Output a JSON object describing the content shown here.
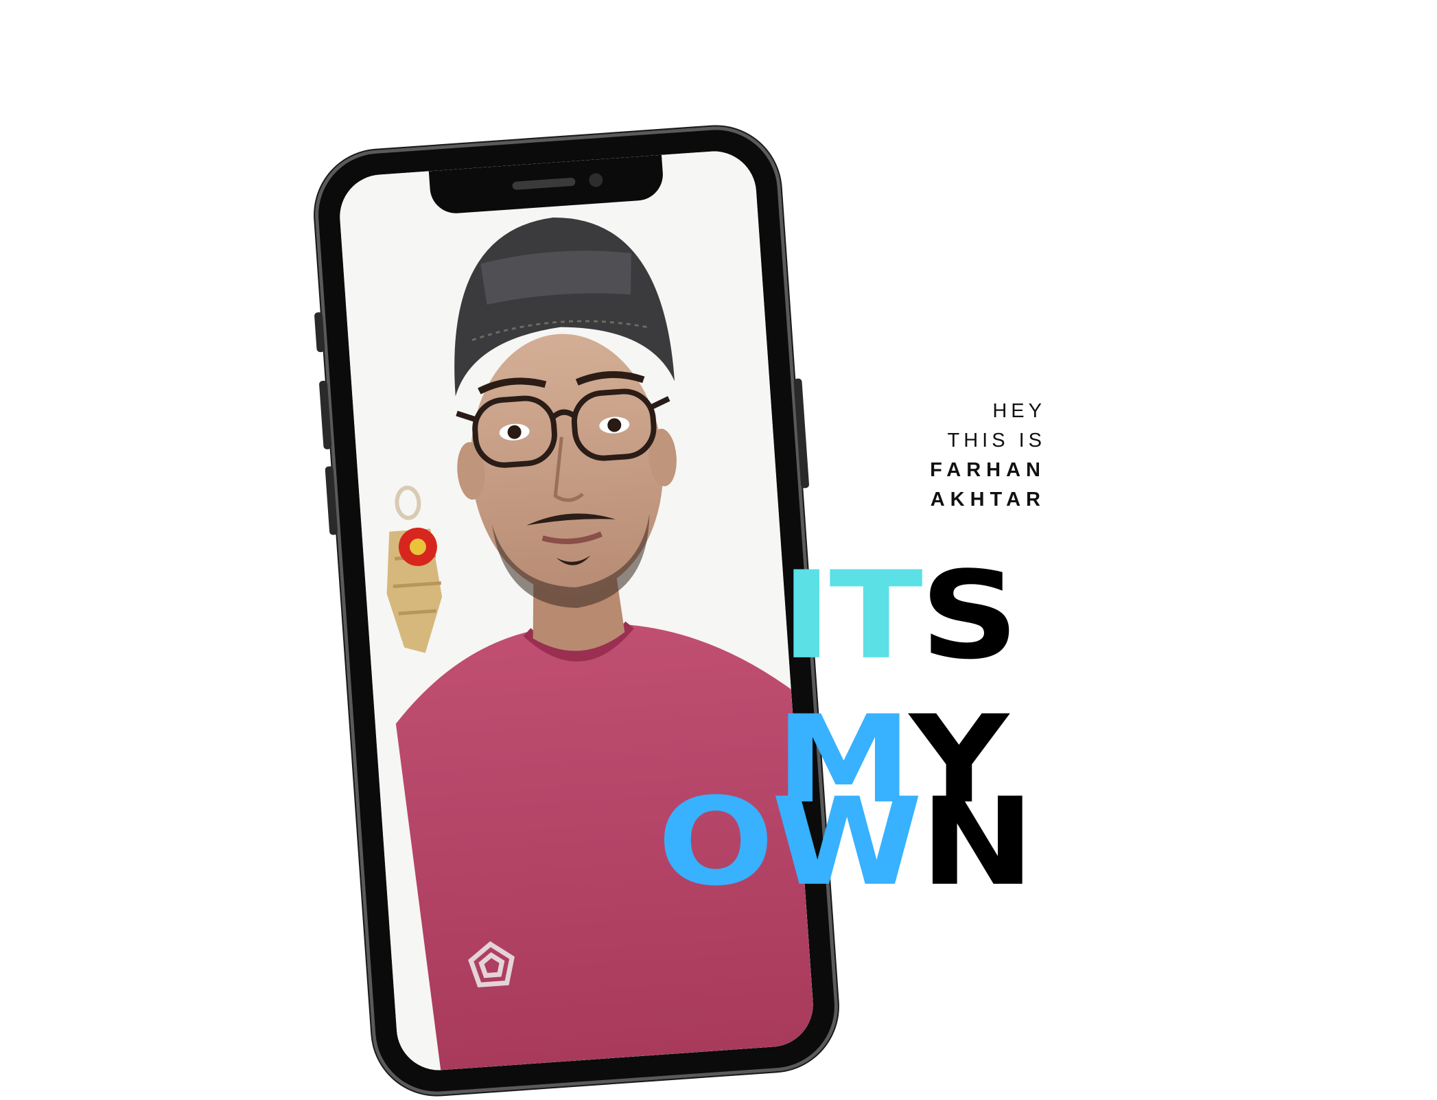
{
  "intro": {
    "line1": "HEY",
    "line2": "THIS IS",
    "line3": "FARHAN",
    "line4": "AKHTAR"
  },
  "headline": {
    "line1": [
      {
        "text": "IT",
        "color": "#5be0e6"
      },
      {
        "text": "S",
        "color": "#000000"
      }
    ],
    "line2": [
      {
        "text": "M",
        "color": "#38b1ff"
      },
      {
        "text": "Y",
        "color": "#000000"
      }
    ],
    "line3": [
      {
        "text": "OW",
        "color": "#38b1ff"
      },
      {
        "text": "N",
        "color": "#000000"
      }
    ]
  },
  "colors": {
    "accent_cyan": "#5be0e6",
    "accent_blue": "#38b1ff",
    "shirt": "#b24566",
    "cap": "#3b3b3d",
    "skin": "#c8a288"
  }
}
